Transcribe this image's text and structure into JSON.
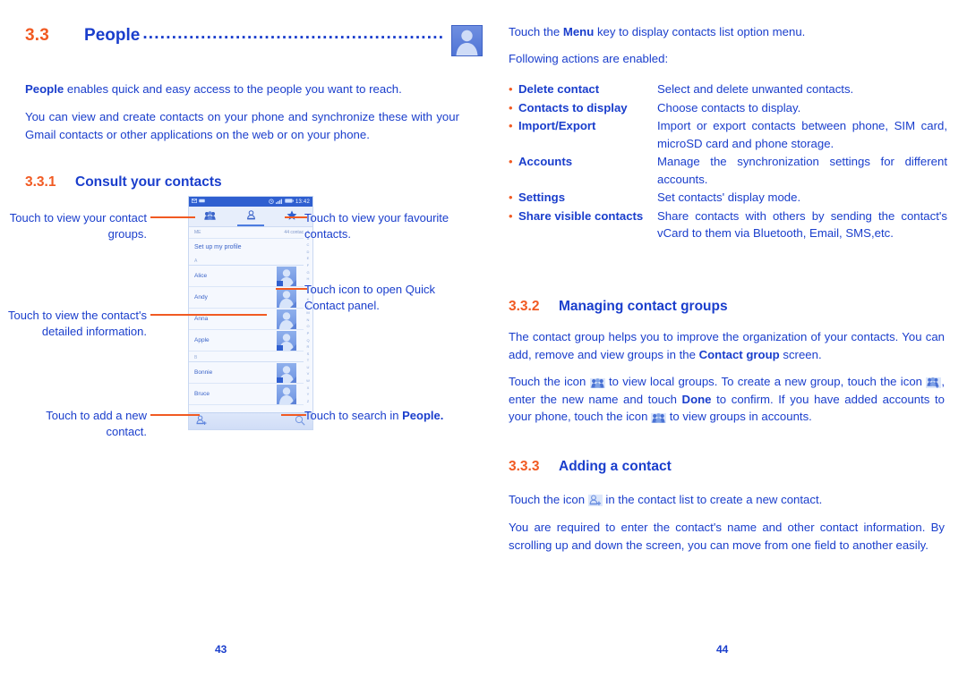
{
  "document": {
    "colors": {
      "heading_number": "#f15a22",
      "heading_text": "#1a3ecc",
      "body_text": "#1a3ecc",
      "bullet": "#f15a22",
      "callout_line": "#f15a22",
      "phone_statusbar": "#2f5fd0"
    }
  },
  "left_page": {
    "section": {
      "number": "3.3",
      "title": "People",
      "leader": "...................................................."
    },
    "header_icon": "contact-avatar-icon",
    "intro": {
      "para1_bold": "People",
      "para1_rest": " enables quick and easy access to the people you want to reach.",
      "para2": "You can view and create contacts on your phone and synchronize these with your Gmail contacts or other applications on the web or on your phone."
    },
    "subsection": {
      "number": "3.3.1",
      "title": "Consult your contacts"
    },
    "callouts": {
      "groups": "Touch to view your contact groups.",
      "favourites": "Touch to view your favourite contacts.",
      "quick_contact": "Touch icon to open Quick Contact panel.",
      "details": "Touch to view the contact's detailed information.",
      "add": "Touch to add a new contact.",
      "search_prefix": "Touch to search in ",
      "search_bold": "People."
    },
    "phone": {
      "statusbar": {
        "time": "13:42",
        "icons": [
          "mail-icon",
          "sim-icon",
          "alarm-icon",
          "signal-icon",
          "battery-icon"
        ]
      },
      "tabs": [
        {
          "name": "groups-tab",
          "icon": "contact-groups-icon",
          "active": false
        },
        {
          "name": "contacts-tab",
          "icon": "single-contact-icon",
          "active": true
        },
        {
          "name": "favourites-tab",
          "icon": "star-icon",
          "active": false
        }
      ],
      "me_label": "ME",
      "contacts_count": "44 contacts",
      "profile_row": "Set up my profile",
      "list": [
        {
          "type": "section",
          "label": "A"
        },
        {
          "type": "contact",
          "name": "Alice",
          "badge": true
        },
        {
          "type": "contact",
          "name": "Andy",
          "badge": false
        },
        {
          "type": "contact",
          "name": "Anna",
          "badge": false
        },
        {
          "type": "contact",
          "name": "Apple",
          "badge": true
        },
        {
          "type": "section",
          "label": "B"
        },
        {
          "type": "contact",
          "name": "Bonnie",
          "badge": true
        },
        {
          "type": "contact",
          "name": "Bruce",
          "badge": false
        }
      ],
      "alpha_index": [
        "A",
        "B",
        "C",
        "D",
        "E",
        "F",
        "G",
        "H",
        "I",
        "J",
        "K",
        "L",
        "M",
        "N",
        "O",
        "P",
        "Q",
        "R",
        "S",
        "T",
        "U",
        "V",
        "W",
        "X",
        "Y",
        "Z"
      ],
      "bottom_bar": [
        {
          "name": "add-contact-button",
          "icon": "add-contact-icon"
        },
        {
          "name": "search-button",
          "icon": "search-icon"
        }
      ]
    },
    "page_number": "43"
  },
  "right_page": {
    "menu_intro_prefix": "Touch the ",
    "menu_intro_bold": "Menu",
    "menu_intro_suffix": " key to display contacts list option menu.",
    "following_actions": "Following actions are enabled:",
    "options": [
      {
        "term": "Delete contact",
        "desc": "Select and delete unwanted contacts."
      },
      {
        "term": "Contacts to display",
        "desc": "Choose contacts to display."
      },
      {
        "term": "Import/Export",
        "desc": "Import or export contacts between phone, SIM card, microSD card and phone storage."
      },
      {
        "term": "Accounts",
        "desc": "Manage the synchronization settings for different accounts."
      },
      {
        "term": "Settings",
        "desc": "Set contacts' display mode."
      },
      {
        "term": "Share visible contacts",
        "desc": "Share contacts with others by sending the contact's vCard to them via Bluetooth, Email, SMS,etc."
      }
    ],
    "subsection_332": {
      "number": "3.3.2",
      "title": "Managing contact groups"
    },
    "para_332_a_1": "The contact group helps you to improve the organization of your contacts. You can add, remove and view groups in the ",
    "para_332_a_bold": "Contact group",
    "para_332_a_2": " screen.",
    "para_332_b_1": "Touch the icon ",
    "para_332_b_2": " to view local groups.  To create a new group, touch the icon ",
    "para_332_b_3": ", enter the new name and touch ",
    "para_332_b_bold": "Done",
    "para_332_b_4": " to confirm. If you have added accounts to your phone, touch the icon ",
    "para_332_b_5": " to view groups in accounts.",
    "subsection_333": {
      "number": "3.3.3",
      "title": "Adding a contact"
    },
    "para_333_a_1": "Touch the icon ",
    "para_333_a_2": " in the contact list to create a new contact.",
    "para_333_b": "You are required to enter the contact's name and other contact information. By scrolling up and down the screen, you can move from one field to another easily.",
    "page_number": "44"
  }
}
